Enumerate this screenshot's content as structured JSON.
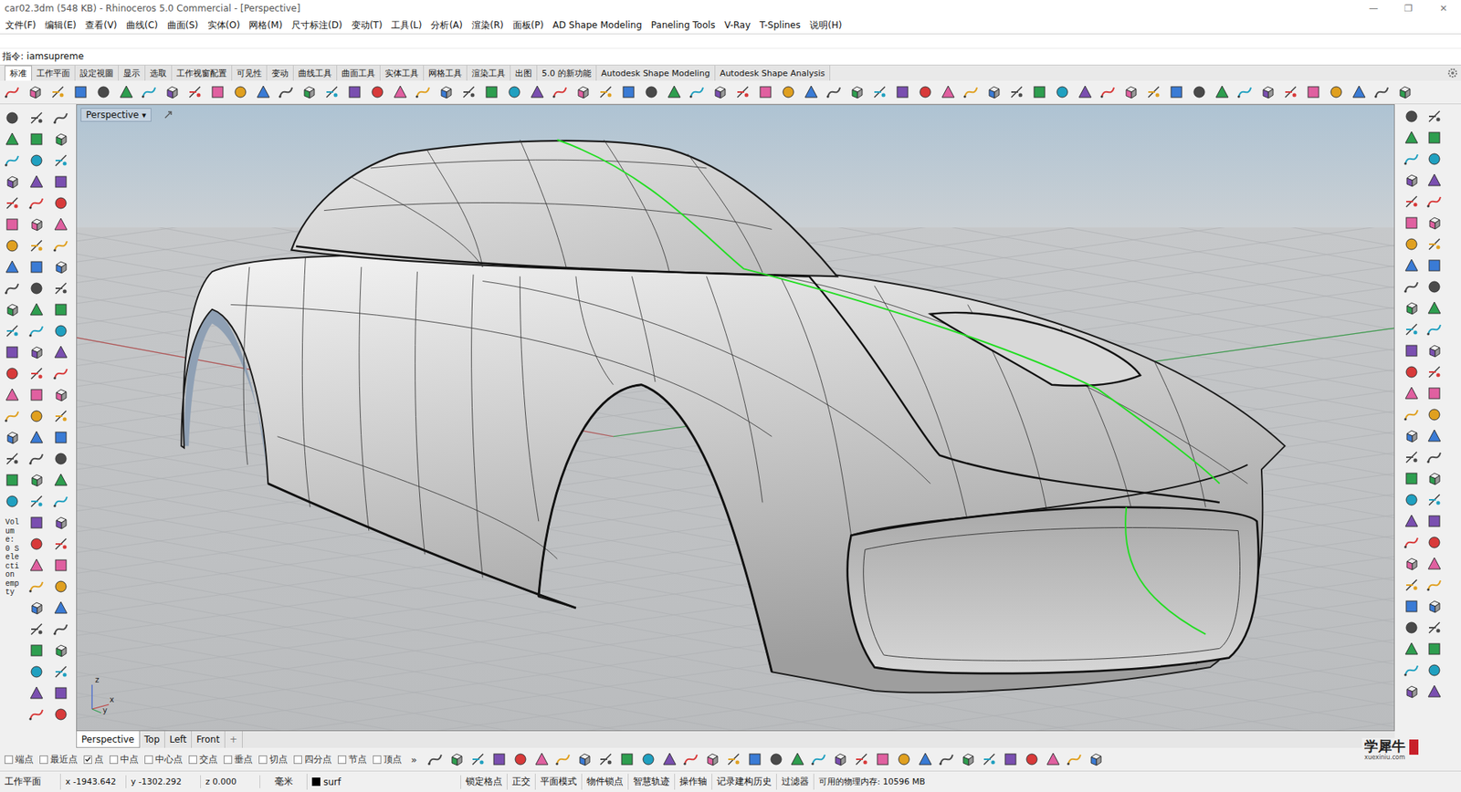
{
  "window": {
    "title": "car02.3dm (548 KB) - Rhinoceros 5.0 Commercial - [Perspective]",
    "controls": [
      "—",
      "❐",
      "✕"
    ]
  },
  "menu": [
    "文件(F)",
    "编辑(E)",
    "查看(V)",
    "曲线(C)",
    "曲面(S)",
    "实体(O)",
    "网格(M)",
    "尺寸标注(D)",
    "变动(T)",
    "工具(L)",
    "分析(A)",
    "渲染(R)",
    "面板(P)",
    "AD Shape Modeling",
    "Paneling Tools",
    "V-Ray",
    "T-Splines",
    "说明(H)"
  ],
  "command": {
    "prompt": "指令:",
    "value": "iamsupreme"
  },
  "toolbar_tabs": [
    {
      "label": "标准",
      "selected": true
    },
    {
      "label": "工作平面",
      "selected": false
    },
    {
      "label": "設定視圖",
      "selected": false
    },
    {
      "label": "显示",
      "selected": false
    },
    {
      "label": "选取",
      "selected": false
    },
    {
      "label": "工作视窗配置",
      "selected": false
    },
    {
      "label": "可见性",
      "selected": false
    },
    {
      "label": "变动",
      "selected": false
    },
    {
      "label": "曲线工具",
      "selected": false
    },
    {
      "label": "曲面工具",
      "selected": false
    },
    {
      "label": "实体工具",
      "selected": false
    },
    {
      "label": "网格工具",
      "selected": false
    },
    {
      "label": "渲染工具",
      "selected": false
    },
    {
      "label": "出图",
      "selected": false
    },
    {
      "label": "5.0 的新功能",
      "selected": false
    },
    {
      "label": "Autodesk Shape Modeling",
      "selected": false
    },
    {
      "label": "Autodesk Shape Analysis",
      "selected": false
    }
  ],
  "left_panel": {
    "info": "Volume: 0 Selection empty"
  },
  "viewport": {
    "label": "Perspective",
    "menu_arrow": "▾",
    "axis_labels": [
      "z",
      "y",
      "x"
    ]
  },
  "view_tabs": [
    {
      "label": "Perspective",
      "selected": true
    },
    {
      "label": "Top",
      "selected": false
    },
    {
      "label": "Left",
      "selected": false
    },
    {
      "label": "Front",
      "selected": false
    }
  ],
  "add_view_tab": "+",
  "osnaps": [
    {
      "label": "端点",
      "checked": false
    },
    {
      "label": "最近点",
      "checked": false
    },
    {
      "label": "点",
      "checked": true
    },
    {
      "label": "中点",
      "checked": false
    },
    {
      "label": "中心点",
      "checked": false
    },
    {
      "label": "交点",
      "checked": false
    },
    {
      "label": "垂点",
      "checked": false
    },
    {
      "label": "切点",
      "checked": false
    },
    {
      "label": "四分点",
      "checked": false
    },
    {
      "label": "节点",
      "checked": false
    },
    {
      "label": "顶点",
      "checked": false
    }
  ],
  "osnap_more": "»",
  "status_bar": {
    "cplane": "工作平面",
    "x": "x -1943.642",
    "y": "y -1302.292",
    "z": "z 0.000",
    "units": "毫米",
    "layer": {
      "name": "surf",
      "color": "#000000"
    },
    "toggles": [
      {
        "label": "锁定格点",
        "on": false
      },
      {
        "label": "正交",
        "on": false
      },
      {
        "label": "平面模式",
        "on": false
      },
      {
        "label": "物件锁点",
        "on": false
      },
      {
        "label": "智慧轨迹",
        "on": false
      },
      {
        "label": "操作轴",
        "on": false
      },
      {
        "label": "记录建构历史",
        "on": false
      },
      {
        "label": "过滤器",
        "on": false
      }
    ],
    "memory": "可用的物理内存: 10596 MB"
  },
  "watermark": {
    "text": "学犀牛",
    "url": "xuexiniu.com"
  }
}
